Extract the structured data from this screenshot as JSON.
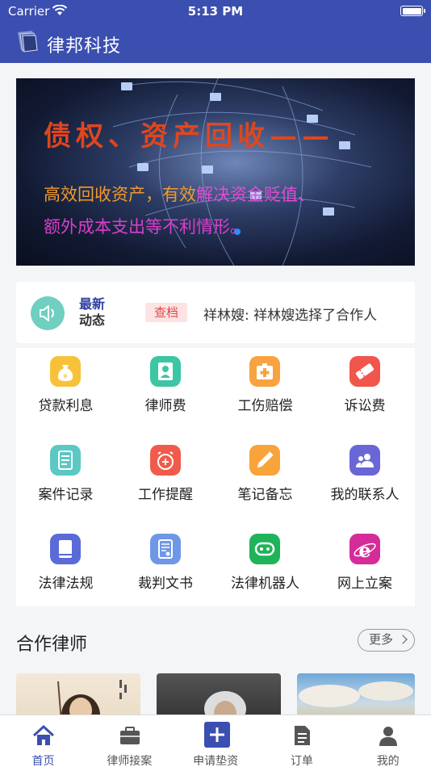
{
  "status_bar": {
    "carrier": "Carrier",
    "time": "5:13 PM"
  },
  "nav": {
    "title": "律邦科技"
  },
  "banner": {
    "headline": "债权、资产回收——",
    "line1_a": "高效回收资产，有效",
    "line1_b": "解决资金贬值、",
    "line2": "额外成本支出等不利情形。"
  },
  "news": {
    "label_top": "最新",
    "label_bottom": "动态",
    "badge": "查档",
    "text": "祥林嫂: 祥林嫂选择了合作人"
  },
  "grid": {
    "items": [
      {
        "label": "贷款利息",
        "icon": "money-bag-icon",
        "color": "#f7c23a"
      },
      {
        "label": "律师费",
        "icon": "lawyer-icon",
        "color": "#3cc6a4"
      },
      {
        "label": "工伤赔偿",
        "icon": "medical-kit-icon",
        "color": "#f9a240"
      },
      {
        "label": "诉讼费",
        "icon": "ticket-icon",
        "color": "#f0564b"
      },
      {
        "label": "案件记录",
        "icon": "document-icon",
        "color": "#5bc8c4"
      },
      {
        "label": "工作提醒",
        "icon": "alarm-clock-icon",
        "color": "#f15b4c"
      },
      {
        "label": "笔记备忘",
        "icon": "pencil-icon",
        "color": "#f8a43a"
      },
      {
        "label": "我的联系人",
        "icon": "contacts-icon",
        "color": "#6a66d6"
      },
      {
        "label": "法律法规",
        "icon": "book-icon",
        "color": "#5a6bd8"
      },
      {
        "label": "裁判文书",
        "icon": "judgment-doc-icon",
        "color": "#6f97e8"
      },
      {
        "label": "法律机器人",
        "icon": "robot-icon",
        "color": "#1fb35a"
      },
      {
        "label": "网上立案",
        "icon": "internet-explorer-icon",
        "color": "#d62b9a"
      }
    ]
  },
  "partners": {
    "title": "合作律师",
    "more": "更多"
  },
  "tabbar": {
    "items": [
      {
        "label": "首页",
        "icon": "home-icon"
      },
      {
        "label": "律师接案",
        "icon": "briefcase-icon"
      },
      {
        "label": "申请垫资",
        "icon": "plus-icon"
      },
      {
        "label": "订单",
        "icon": "order-list-icon"
      },
      {
        "label": "我的",
        "icon": "user-icon"
      }
    ],
    "active_color": "#3b4fb0"
  }
}
